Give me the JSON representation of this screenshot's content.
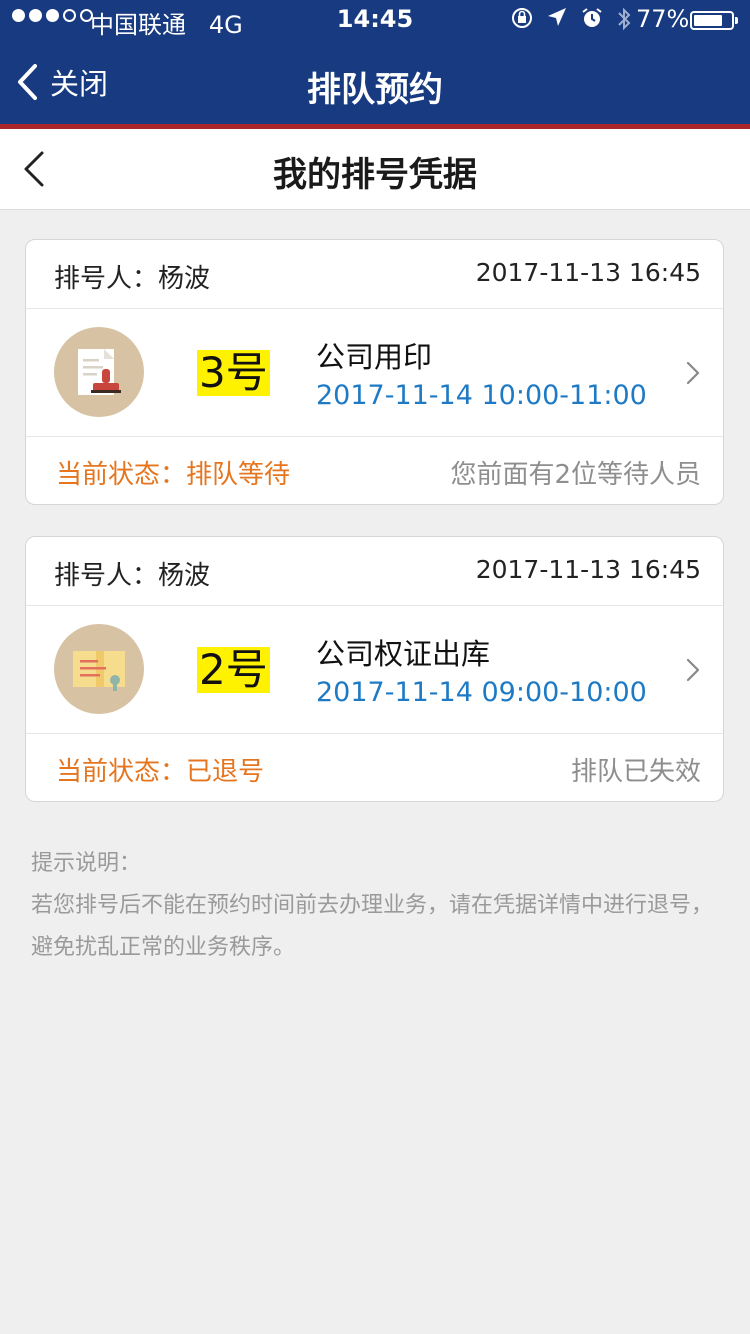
{
  "status_bar": {
    "carrier": "中国联通",
    "network": "4G",
    "time": "14:45",
    "battery": "77%",
    "battery_level": 0.77
  },
  "nav": {
    "close_label": "关闭",
    "title": "排队预约"
  },
  "subheader": {
    "title": "我的排号凭据"
  },
  "tickets": [
    {
      "person_label": "排号人：",
      "person_name": "杨波",
      "issued": "2017-11-13 16:45",
      "icon": "stamp-icon",
      "number": "3号",
      "service": "公司用印",
      "slot": "2017-11-14 10:00-11:00",
      "state_label": "当前状态：",
      "state_value": "排队等待",
      "note": "您前面有2位等待人员"
    },
    {
      "person_label": "排号人：",
      "person_name": "杨波",
      "issued": "2017-11-13 16:45",
      "icon": "certificate-icon",
      "number": "2号",
      "service": "公司权证出库",
      "slot": "2017-11-14 09:00-10:00",
      "state_label": "当前状态：",
      "state_value": "已退号",
      "note": "排队已失效"
    }
  ],
  "tips": {
    "title": "提示说明：",
    "text": "若您排号后不能在预约时间前去办理业务，请在凭据详情中进行退号，避免扰乱正常的业务秩序。"
  },
  "colors": {
    "nav_bg": "#173a80",
    "accent_line": "#a8252a",
    "state_orange": "#e5761f",
    "slot_blue": "#1e7ac4",
    "number_highlight": "#fff200"
  }
}
